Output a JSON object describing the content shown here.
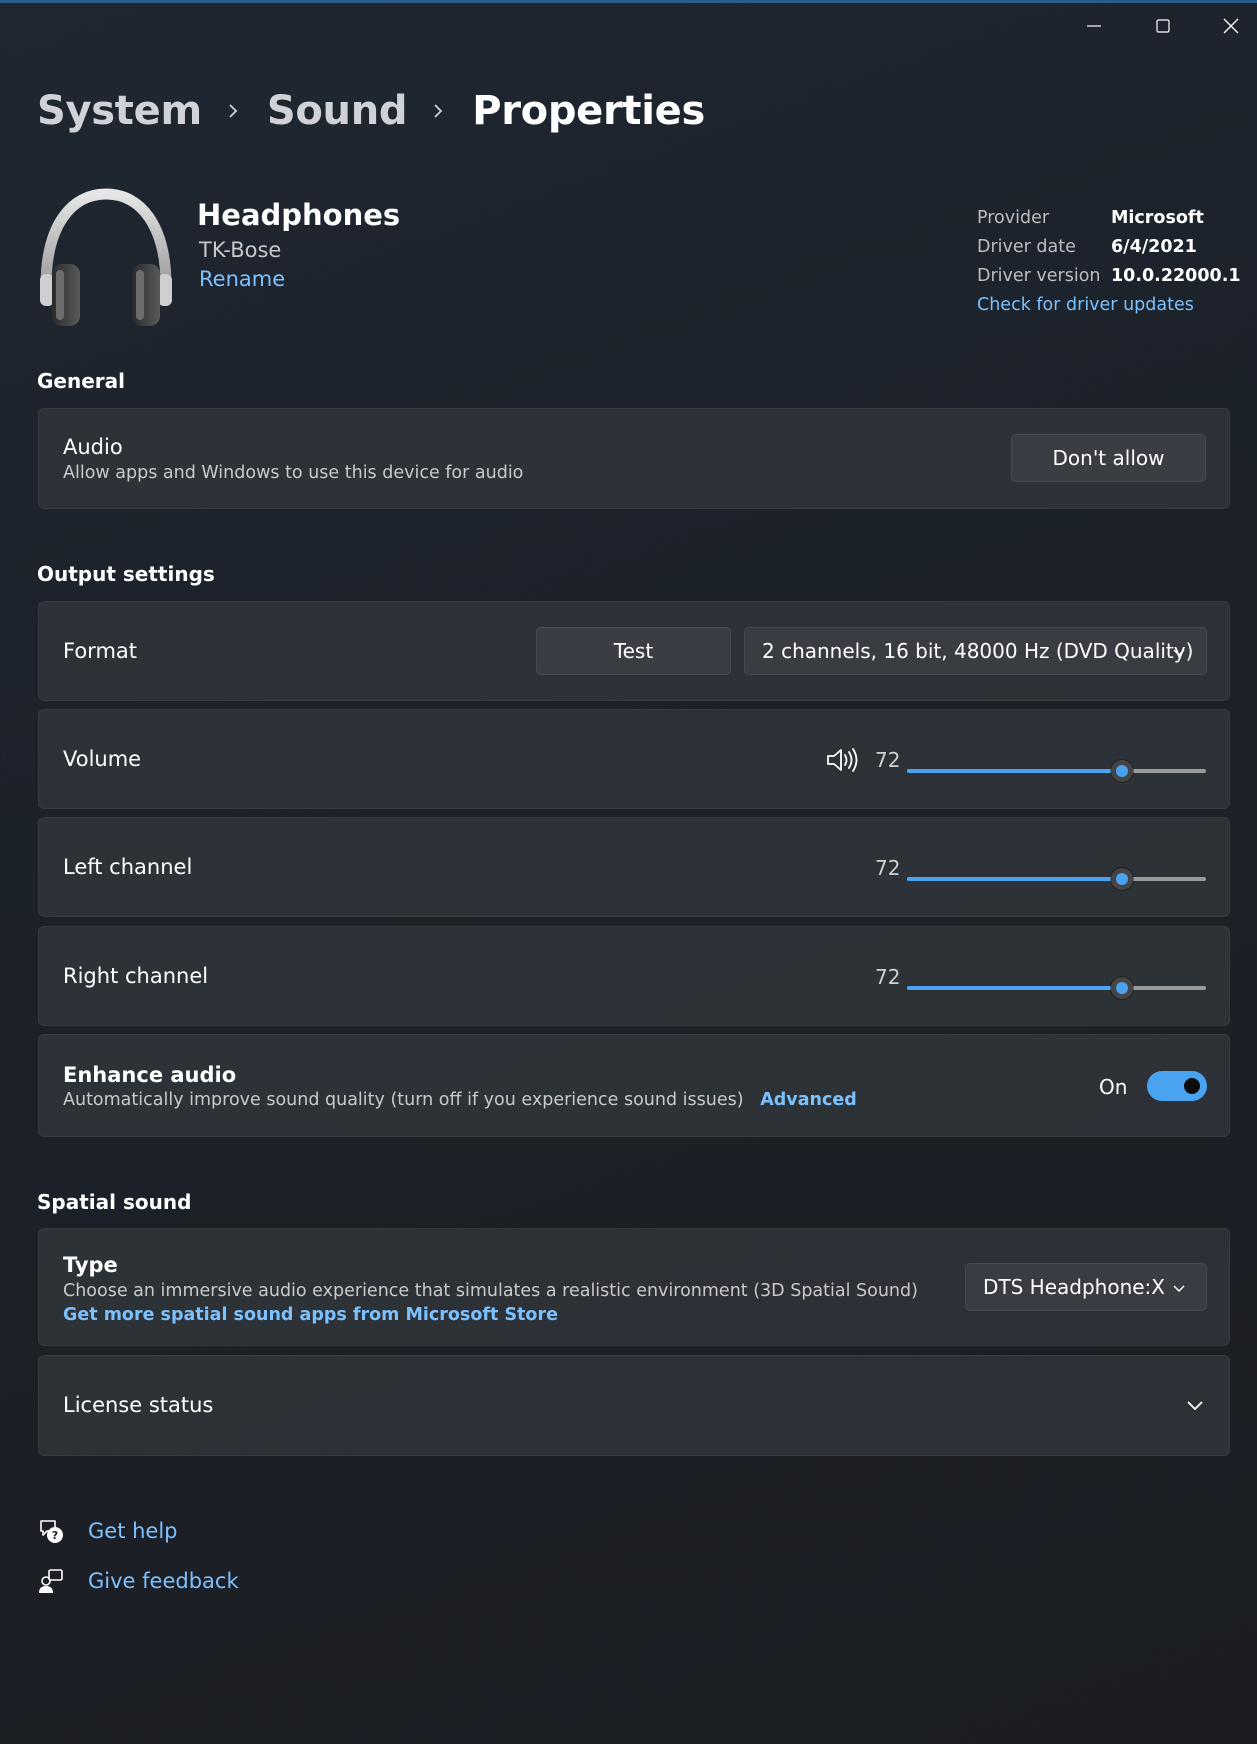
{
  "window": {
    "controls": [
      "minimize",
      "maximize",
      "close"
    ]
  },
  "breadcrumb": [
    {
      "label": "System"
    },
    {
      "label": "Sound"
    },
    {
      "label": "Properties"
    }
  ],
  "device": {
    "icon": "headphones-icon",
    "name": "Headphones",
    "subtitle": "TK-Bose",
    "rename_label": "Rename"
  },
  "driver": {
    "provider_label": "Provider",
    "provider_value": "Microsoft",
    "date_label": "Driver date",
    "date_value": "6/4/2021",
    "version_label": "Driver version",
    "version_value": "10.0.22000.1",
    "update_link": "Check for driver updates"
  },
  "general": {
    "title": "General",
    "audio": {
      "title": "Audio",
      "description": "Allow apps and Windows to use this device for audio",
      "button": "Don't allow"
    }
  },
  "output": {
    "title": "Output settings",
    "format": {
      "title": "Format",
      "test_button": "Test",
      "selected": "2 channels, 16 bit, 48000 Hz (DVD Quality)"
    },
    "volume": {
      "title": "Volume",
      "icon": "speaker-icon",
      "value": "72",
      "level": 0.72
    },
    "left_channel": {
      "title": "Left channel",
      "value": "72",
      "level": 0.72
    },
    "right_channel": {
      "title": "Right channel",
      "value": "72",
      "level": 0.72
    },
    "enhance": {
      "title": "Enhance audio",
      "description": "Automatically improve sound quality (turn off if you experience sound issues)",
      "advanced_link": "Advanced",
      "toggle_label": "On",
      "toggle_on": true
    }
  },
  "spatial": {
    "title": "Spatial sound",
    "type": {
      "title": "Type",
      "description": "Choose an immersive audio experience that simulates a realistic environment (3D Spatial Sound)",
      "store_link": "Get more spatial sound apps from Microsoft Store",
      "selected": "DTS Headphone:X"
    },
    "license": {
      "title": "License status"
    }
  },
  "footer": {
    "help": {
      "label": "Get help",
      "icon": "help-chat-icon"
    },
    "feedback": {
      "label": "Give feedback",
      "icon": "feedback-icon"
    }
  },
  "colors": {
    "accent": "#4aa3f0",
    "link": "#7cc1ff",
    "background": "#1c2129",
    "card": "#30343a"
  }
}
